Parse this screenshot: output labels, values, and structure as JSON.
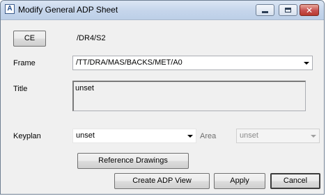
{
  "window": {
    "title": "Modify General ADP Sheet",
    "app_icon_glyph": "A"
  },
  "ce": {
    "button_label": "CE",
    "path": "/DR4/S2"
  },
  "frame": {
    "label": "Frame",
    "value": "/TT/DRA/MAS/BACKS/MET/A0"
  },
  "title_field": {
    "label": "Title",
    "value": "unset"
  },
  "keyplan": {
    "label": "Keyplan",
    "value": "unset"
  },
  "area": {
    "label": "Area",
    "value": "unset"
  },
  "buttons": {
    "reference_drawings": "Reference Drawings",
    "create_adp_view": "Create ADP View",
    "apply": "Apply",
    "cancel": "Cancel"
  },
  "icons": {
    "minimize": "minimize-icon",
    "maximize": "maximize-icon",
    "close": "close-icon"
  }
}
